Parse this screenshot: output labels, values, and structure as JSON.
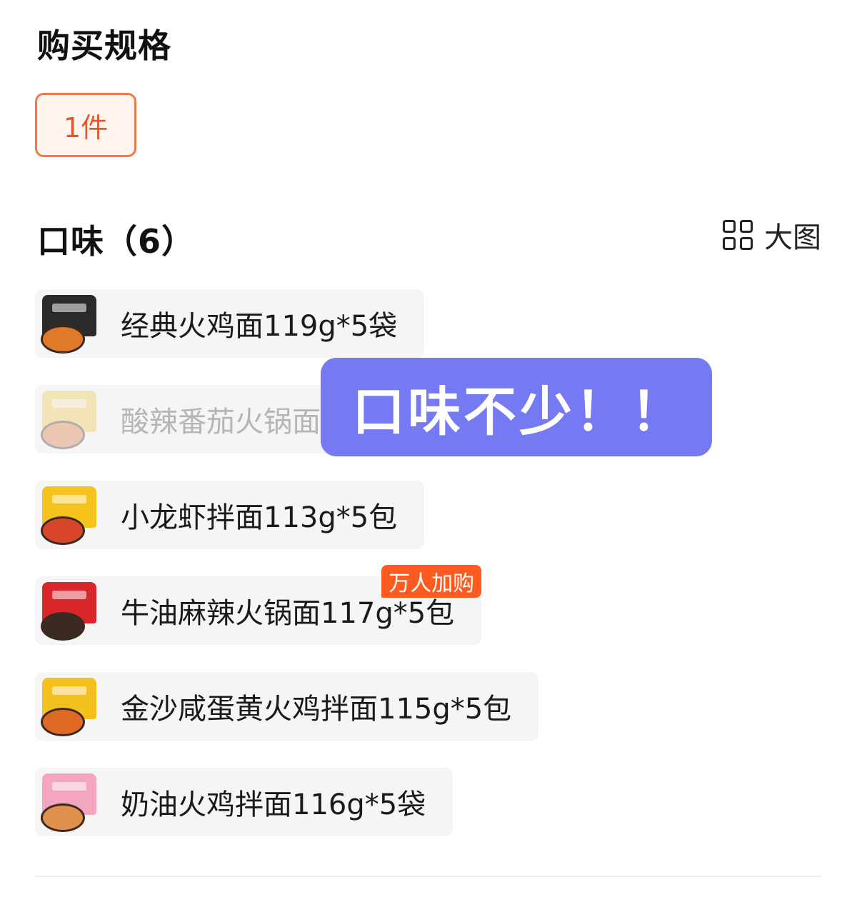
{
  "spec": {
    "title": "购买规格",
    "options": [
      {
        "label": "1件",
        "selected": true
      }
    ]
  },
  "flavor": {
    "title": "口味（6）",
    "view_toggle_label": "大图",
    "view_toggle_icon": "grid-icon",
    "items": [
      {
        "name": "经典火鸡面119g*5袋",
        "disabled": false,
        "badge": "",
        "thumb_colors": [
          "#2a2a2a",
          "#e07a2a"
        ]
      },
      {
        "name": "酸辣番茄火锅面12",
        "disabled": true,
        "badge": "",
        "thumb_colors": [
          "#f2c64a",
          "#d9733a"
        ]
      },
      {
        "name": "小龙虾拌面113g*5包",
        "disabled": false,
        "badge": "",
        "thumb_colors": [
          "#f6c21c",
          "#d8462a"
        ]
      },
      {
        "name": "牛油麻辣火锅面117g*5包",
        "disabled": false,
        "badge": "万人加购",
        "thumb_colors": [
          "#d8262a",
          "#3a2a22"
        ]
      },
      {
        "name": "金沙咸蛋黄火鸡拌面115g*5包",
        "disabled": false,
        "badge": "",
        "thumb_colors": [
          "#f4c01e",
          "#e06a24"
        ]
      },
      {
        "name": "奶油火鸡拌面116g*5袋",
        "disabled": false,
        "badge": "",
        "thumb_colors": [
          "#f4a6c0",
          "#e0904a"
        ]
      }
    ]
  },
  "overlay": {
    "text": "口味不少！！"
  },
  "colors": {
    "accent": "#e4582a",
    "badge": "#ff5a1f",
    "overlay": "#7579f2"
  }
}
